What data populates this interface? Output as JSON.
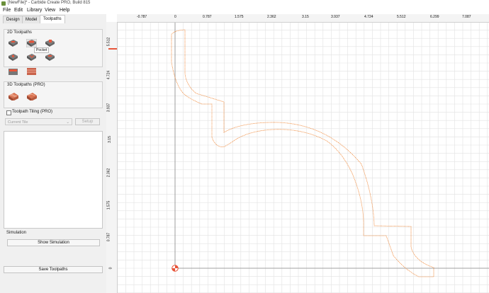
{
  "window": {
    "title": "[NewFile]* - Carbide Create PRO, Build 815"
  },
  "menu": [
    "File",
    "Edit",
    "Library",
    "View",
    "Help"
  ],
  "tabs": [
    "Design",
    "Model",
    "Toolpaths"
  ],
  "active_tab": "Toolpaths",
  "toolpaths_2d": {
    "label": "2D Toolpaths",
    "tooltip": "Pocket",
    "tools": [
      "contour-toolpath-icon",
      "pocket-toolpath-icon",
      "drill-toolpath-icon",
      "engrave-toolpath-icon",
      "vcarve-toolpath-icon",
      "texture-toolpath-icon",
      "advanced-vcarve-icon",
      "rough-toolpath-icon"
    ]
  },
  "toolpaths_3d": {
    "label": "3D Toolpaths (PRO)",
    "tools": [
      "3d-rough-icon",
      "3d-finish-icon"
    ]
  },
  "tiling": {
    "label": "Toolpath Tiling (PRO)",
    "current_tile": "Current Tile",
    "setup_label": "Setup"
  },
  "simulation": {
    "label": "Simulation",
    "show_label": "Show Simulation"
  },
  "save_label": "Save Toolpaths",
  "ruler": {
    "x_labels": [
      "-0.787",
      "0",
      "0.787",
      "1.575",
      "2.362",
      "3.15",
      "3.937",
      "4.724",
      "5.512",
      "6.299",
      "7.087"
    ],
    "y_labels": [
      "5.512",
      "4.724",
      "3.937",
      "3.15",
      "2.362",
      "1.575",
      "0.787",
      "0"
    ]
  },
  "colors": {
    "accent": "#e8553a",
    "grid": "#e2e2e2",
    "toolpath": "#f08a3c"
  }
}
